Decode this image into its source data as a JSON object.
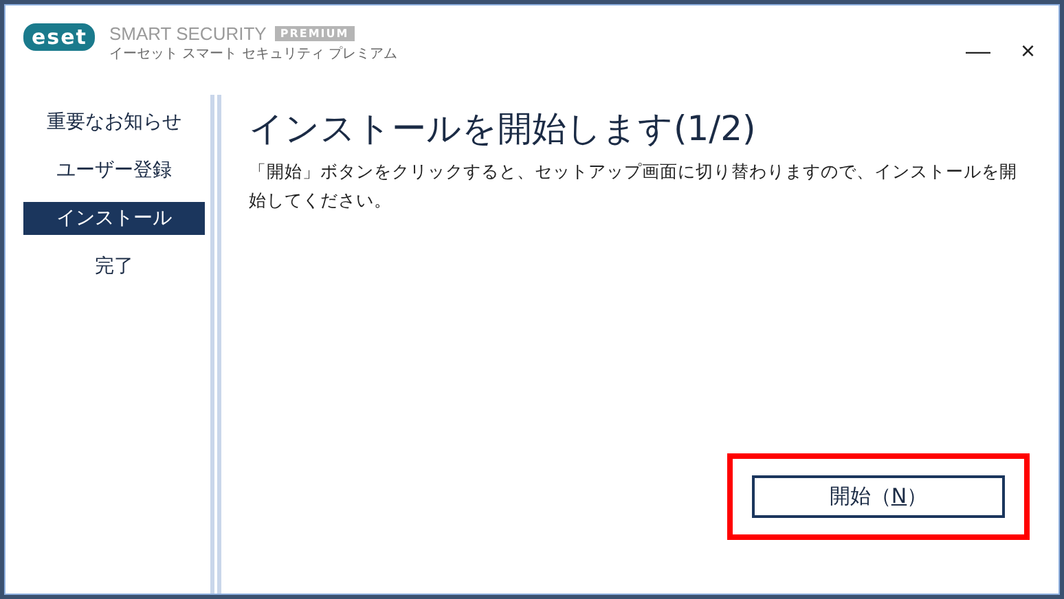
{
  "header": {
    "logo": "eset",
    "product": "SMART SECURITY",
    "badge": "PREMIUM",
    "subtitle": "イーセット スマート セキュリティ プレミアム",
    "minimize": "—",
    "close": "×"
  },
  "sidebar": {
    "items": [
      {
        "label": "重要なお知らせ",
        "selected": false
      },
      {
        "label": "ユーザー登録",
        "selected": false
      },
      {
        "label": "インストール",
        "selected": true
      },
      {
        "label": "完了",
        "selected": false
      }
    ]
  },
  "content": {
    "title": "インストールを開始します(1/2)",
    "message": "「開始」ボタンをクリックすると、セットアップ画面に切り替わりますので、インストールを開始してください。"
  },
  "start_button": {
    "label_before": "開始（",
    "mnemonic": "N",
    "label_after": "）",
    "highlighted": true
  }
}
